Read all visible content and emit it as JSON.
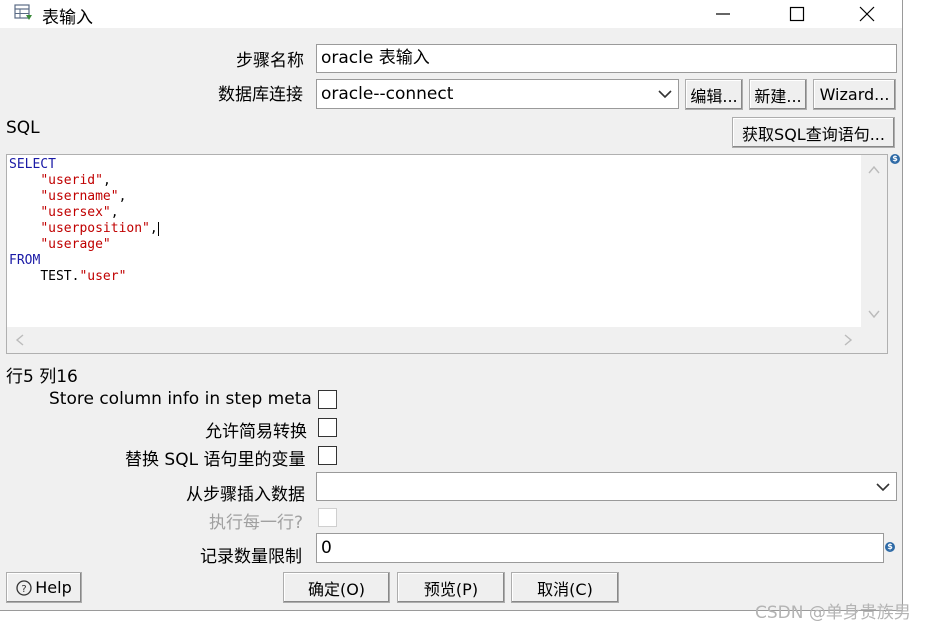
{
  "window": {
    "title": "表输入",
    "icon": "table-input-icon"
  },
  "form": {
    "step_name_label": "步骤名称",
    "step_name_value": "oracle 表输入",
    "db_conn_label": "数据库连接",
    "db_conn_value": "oracle--connect",
    "edit_btn": "编辑...",
    "new_btn": "新建...",
    "wizard_btn": "Wizard...",
    "sql_label": "SQL",
    "get_sql_btn": "获取SQL查询语句...",
    "row_col_status": "行5 列16",
    "store_column_label": "Store column info in step meta",
    "lazy_conv_label": "允许简易转换",
    "replace_var_label": "替换 SQL 语句里的变量",
    "insert_from_label": "从步骤插入数据",
    "insert_from_value": "",
    "exec_each_row_label": "执行每一行?",
    "limit_label": "记录数量限制",
    "limit_value": "0"
  },
  "sql": {
    "line1_kw": "SELECT",
    "line2": "\"userid\"",
    "line3": "\"username\"",
    "line4": "\"usersex\"",
    "line5": "\"userposition\"",
    "line6": "\"userage\"",
    "line7_kw": "FROM",
    "line8_schema": "TEST.",
    "line8_table": "\"user\""
  },
  "footer": {
    "help_btn": "Help",
    "ok_btn": "确定(O)",
    "preview_btn": "预览(P)",
    "cancel_btn": "取消(C)"
  },
  "watermark": "CSDN @单身贵族男",
  "colors": {
    "keyword": "#1a1aa6",
    "string": "#c00000",
    "variable_icon": "#2e6aa6"
  }
}
